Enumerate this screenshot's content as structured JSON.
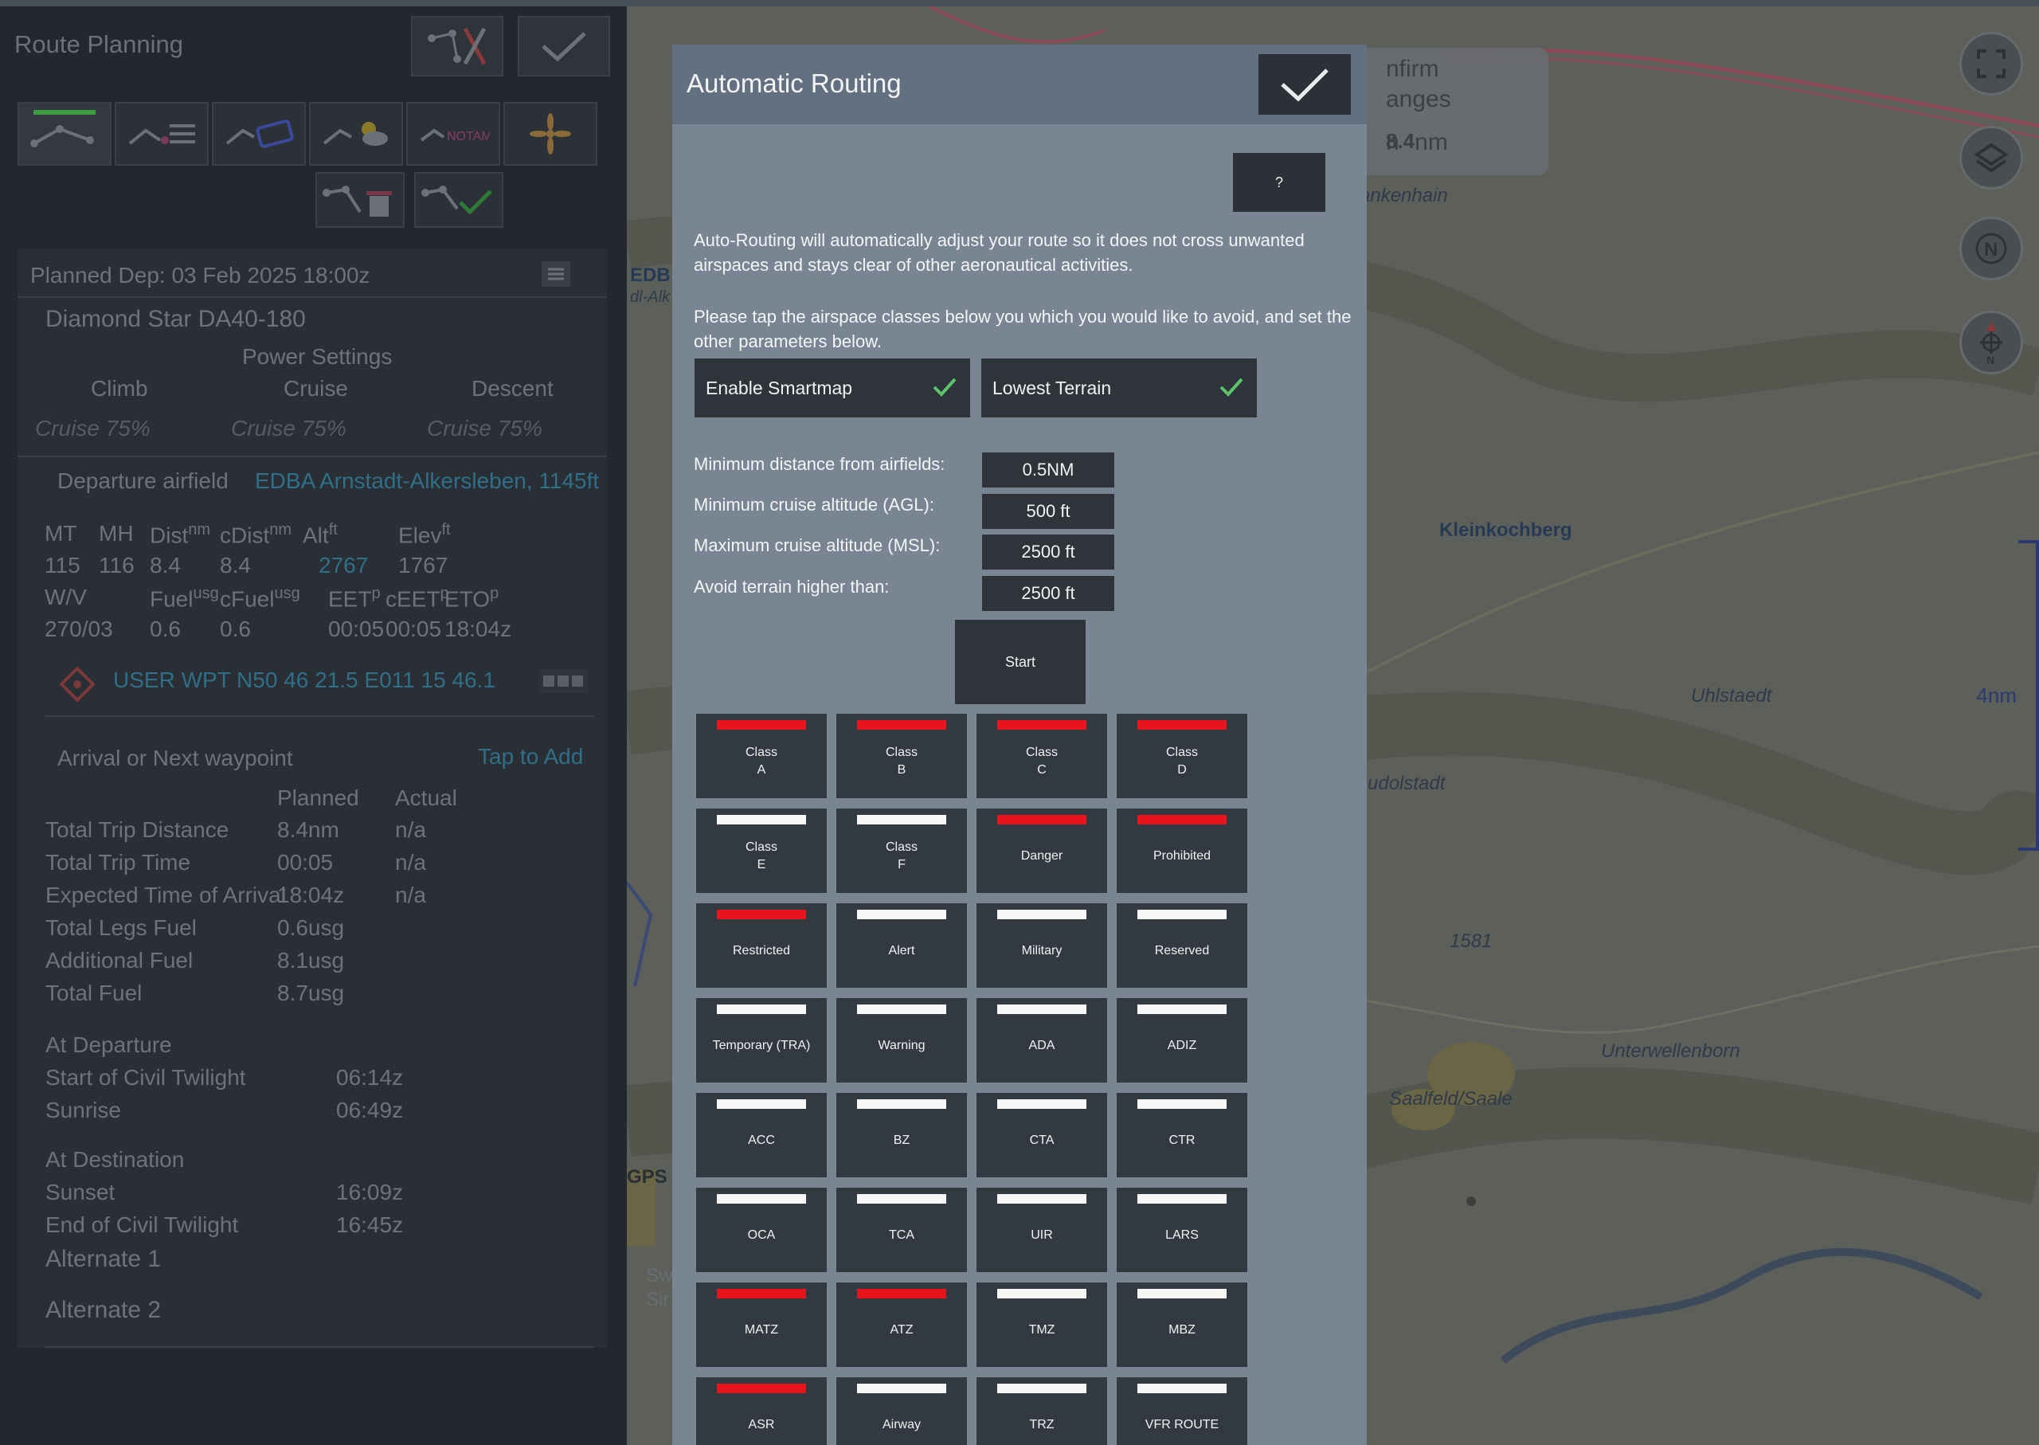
{
  "left": {
    "title": "Route Planning",
    "planned_dep": "Planned Dep: 03 Feb 2025 18:00z",
    "aircraft": "Diamond Star DA40-180",
    "power_settings": "Power Settings",
    "phases": [
      "Climb",
      "Cruise",
      "Descent"
    ],
    "power_values": [
      "Cruise 75%",
      "Cruise 75%",
      "Cruise 75%"
    ],
    "departure_label": "Departure airfield",
    "departure_value": "EDBA Arnstadt-Alkersleben, 1145ft",
    "leg_headers": {
      "mt": "MT",
      "mh": "MH",
      "dist": "Dist",
      "dist_unit": "nm",
      "cdist": "cDist",
      "cdist_unit": "nm",
      "alt": "Alt",
      "alt_unit": "ft",
      "elev": "Elev",
      "elev_unit": "ft"
    },
    "leg_values": {
      "mt": "115",
      "mh": "116",
      "dist": "8.4",
      "cdist": "8.4",
      "alt": "2767",
      "elev": "1767"
    },
    "leg_headers2": {
      "wv": "W/V",
      "fuel": "Fuel",
      "fuel_unit": "usg",
      "cfuel": "cFuel",
      "cfuel_unit": "usg",
      "eet": "EET",
      "eet_unit": "p",
      "ceet": "cEET",
      "ceet_unit": "p",
      "eto": "ETO",
      "eto_unit": "p"
    },
    "leg_values2": {
      "wv": "270/03",
      "fuel": "0.6",
      "cfuel": "0.6",
      "eet": "00:05",
      "ceet": "00:05",
      "eto": "18:04z"
    },
    "waypoint": "USER WPT N50 46 21.5 E011 15 46.1",
    "arrival_label": "Arrival or Next waypoint",
    "tap_to_add": "Tap to Add",
    "summary_headers": [
      "Planned",
      "Actual"
    ],
    "summary": [
      {
        "label": "Total Trip Distance",
        "planned": "8.4nm",
        "actual": "n/a"
      },
      {
        "label": "Total Trip Time",
        "planned": "00:05",
        "actual": "n/a"
      },
      {
        "label": "Expected Time of Arrival",
        "planned": "18:04z",
        "actual": "n/a"
      },
      {
        "label": "Total Legs Fuel",
        "planned": "0.6usg",
        "actual": ""
      },
      {
        "label": "Additional Fuel",
        "planned": "8.1usg",
        "actual": ""
      },
      {
        "label": "Total Fuel",
        "planned": "8.7usg",
        "actual": ""
      }
    ],
    "at_departure": "At Departure",
    "dep_rows": [
      {
        "label": "Start of Civil Twilight",
        "value": "06:14z"
      },
      {
        "label": "Sunrise",
        "value": "06:49z"
      }
    ],
    "at_destination": "At Destination",
    "dest_rows": [
      {
        "label": "Sunset",
        "value": "16:09z"
      },
      {
        "label": "End of Civil Twilight",
        "value": "16:45z"
      }
    ],
    "alternate1": "Alternate 1",
    "alternate2": "Alternate 2"
  },
  "map": {
    "labels": {
      "kleinkochberg": "Kleinkochberg",
      "uhlstaedt": "Uhlstaedt",
      "rudolstadt": "udolstadt",
      "unterwellenborn": "Unterwellenborn",
      "saalfeld": "Saalfeld/Saale",
      "blankenhain": "ankenhain",
      "elev": "1581",
      "edba": "EDB",
      "alke": "dl-Alk",
      "gps": "GPS",
      "sw": "Sw",
      "si": "Sir"
    },
    "confirm": {
      "line1": "nfirm",
      "line2": "anges",
      "dist_prefix": "n",
      "dist_value": "8.4",
      "dist_unit": "nm"
    },
    "scale": "4nm",
    "controls": [
      "fullscreen-icon",
      "layers-icon",
      "north-up-icon",
      "compass-icon"
    ]
  },
  "modal": {
    "title": "Automatic Routing",
    "help": "?",
    "para1": "Auto-Routing will automatically adjust your route so it does not cross unwanted airspaces and stays clear of other aeronautical activities.",
    "para2": "Please tap the airspace classes below you which you would like to avoid, and set the other parameters below.",
    "toggles": [
      {
        "label": "Enable Smartmap",
        "checked": true
      },
      {
        "label": "Lowest Terrain",
        "checked": true
      }
    ],
    "params": [
      {
        "label": "Minimum distance from airfields:",
        "value": "0.5NM"
      },
      {
        "label": "Minimum cruise altitude (AGL):",
        "value": "500 ft"
      },
      {
        "label": "Maximum cruise altitude (MSL):",
        "value": "2500 ft"
      },
      {
        "label": "Avoid terrain higher than:",
        "value": "2500 ft"
      }
    ],
    "start": "Start",
    "active_color": "#e8141b",
    "inactive_color": "#f6f6f6",
    "airspaces": [
      {
        "label": "Class\nA",
        "active": true
      },
      {
        "label": "Class\nB",
        "active": true
      },
      {
        "label": "Class\nC",
        "active": true
      },
      {
        "label": "Class\nD",
        "active": true
      },
      {
        "label": "Class\nE",
        "active": false
      },
      {
        "label": "Class\nF",
        "active": false
      },
      {
        "label": "Danger",
        "active": true
      },
      {
        "label": "Prohibited",
        "active": true
      },
      {
        "label": "Restricted",
        "active": true
      },
      {
        "label": "Alert",
        "active": false
      },
      {
        "label": "Military",
        "active": false
      },
      {
        "label": "Reserved",
        "active": false
      },
      {
        "label": "Temporary (TRA)",
        "active": false
      },
      {
        "label": "Warning",
        "active": false
      },
      {
        "label": "ADA",
        "active": false
      },
      {
        "label": "ADIZ",
        "active": false
      },
      {
        "label": "ACC",
        "active": false
      },
      {
        "label": "BZ",
        "active": false
      },
      {
        "label": "CTA",
        "active": false
      },
      {
        "label": "CTR",
        "active": false
      },
      {
        "label": "OCA",
        "active": false
      },
      {
        "label": "TCA",
        "active": false
      },
      {
        "label": "UIR",
        "active": false
      },
      {
        "label": "LARS",
        "active": false
      },
      {
        "label": "MATZ",
        "active": true
      },
      {
        "label": "ATZ",
        "active": true
      },
      {
        "label": "TMZ",
        "active": false
      },
      {
        "label": "MBZ",
        "active": false
      },
      {
        "label": "ASR",
        "active": true
      },
      {
        "label": "Airway",
        "active": false
      },
      {
        "label": "TRZ",
        "active": false
      },
      {
        "label": "VFR ROUTE",
        "active": false
      }
    ]
  }
}
